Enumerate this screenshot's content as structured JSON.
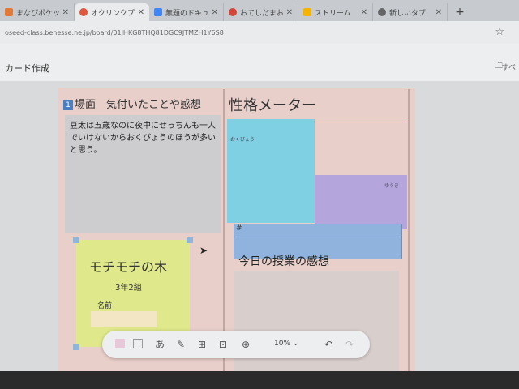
{
  "tabs": [
    {
      "title": "まなびポケット",
      "favicon_color": "#e07a3b"
    },
    {
      "title": "オクリンクプラス",
      "favicon_color": "#e0573b",
      "active": true
    },
    {
      "title": "無題のドキュメント",
      "favicon_color": "#4285f4"
    },
    {
      "title": "おてしだまお",
      "favicon_color": "#d44638"
    },
    {
      "title": "ストリーム",
      "favicon_color": "#f4b400"
    },
    {
      "title": "新しいタブ",
      "favicon_color": "#666666"
    }
  ],
  "address_bar": {
    "url": "oseed-class.benesse.ne.jp/board/01JHKG8THQ81DGC9JTMZH1Y6S8"
  },
  "app_bar": {
    "title": "カード作成",
    "folder_label": "すべ"
  },
  "board": {
    "section1": {
      "number": "1",
      "title": "場面　気付いたことや感想",
      "note_text": "豆太は五歳なのに夜中にせっちんも一人でいけないからおくびょうのほうが多いと思う。"
    },
    "section2": {
      "title": "性格メーター",
      "cyan_label": "おくびょう",
      "purple_label": "ゆうき",
      "hash": "#",
      "impression_label": "今日の授業の感想"
    },
    "card": {
      "title": "モチモチの木",
      "class": "3年2組",
      "name_label": "名前",
      "name_value": ""
    }
  },
  "toolbar": {
    "zoom": "10%"
  },
  "colors": {
    "board_bg": "#e8cfca",
    "cyan_note": "#7ed0e2",
    "purple_note": "#b4a6dc",
    "blue_note": "#8fb3dc",
    "yellow_card": "#dfe88a"
  },
  "icons": {
    "tool_text_translate": "text-translate-icon",
    "tool_pen": "pen-icon",
    "tool_add_card": "add-card-icon",
    "tool_camera": "camera-icon",
    "tool_web": "globe-icon",
    "undo": "undo-icon",
    "redo": "redo-icon"
  }
}
